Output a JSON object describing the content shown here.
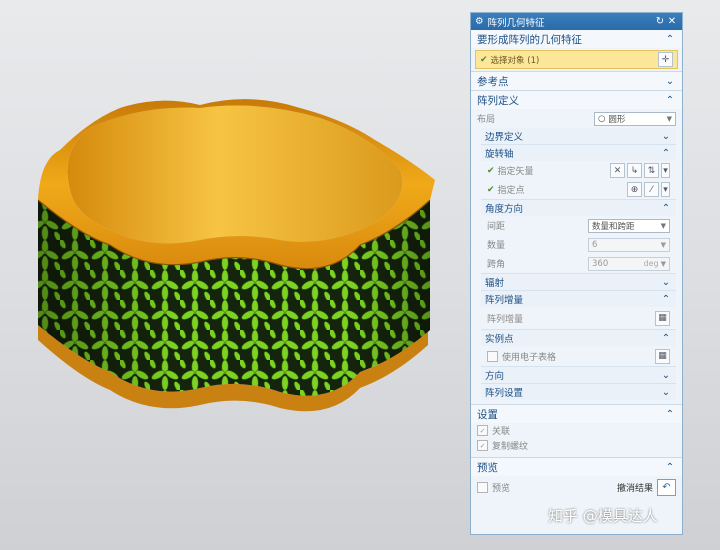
{
  "dialog": {
    "title": "阵列几何特征",
    "reset_icon": "reset-icon",
    "close_icon": "close-icon"
  },
  "feature_section": {
    "title": "要形成阵列的几何特征",
    "select_object": "选择对象 (1)"
  },
  "ref_point": {
    "title": "参考点"
  },
  "array_def": {
    "title": "阵列定义",
    "layout_label": "布局",
    "layout_value": "圆形",
    "boundary": {
      "title": "边界定义"
    },
    "rotation_axis": {
      "title": "旋转轴",
      "vector_label": "指定矢量",
      "point_label": "指定点"
    },
    "angle_direction": {
      "title": "角度方向",
      "spacing_label": "间距",
      "spacing_value": "数量和跨距",
      "count_label": "数量",
      "count_value": "6",
      "span_label": "跨角",
      "span_value": "360",
      "span_unit": "deg"
    },
    "radiate": {
      "title": "辐射"
    },
    "increment": {
      "title": "阵列增量",
      "label": "阵列增量"
    },
    "instance": {
      "title": "实例点",
      "spreadsheet_label": "使用电子表格"
    },
    "direction": {
      "title": "方向"
    },
    "settings_sub": {
      "title": "阵列设置"
    }
  },
  "settings": {
    "title": "设置",
    "associative_label": "关联",
    "copy_threads_label": "复制螺纹"
  },
  "preview": {
    "title": "预览",
    "preview_label": "预览",
    "undo_label": "撤消结果"
  },
  "watermark": "知乎 @模具达人",
  "colors": {
    "title_bar": "#2f72b0",
    "selection_highlight": "#fbe69a",
    "ring_gold": "#e9a11b",
    "leaf_green": "#7cd321"
  }
}
